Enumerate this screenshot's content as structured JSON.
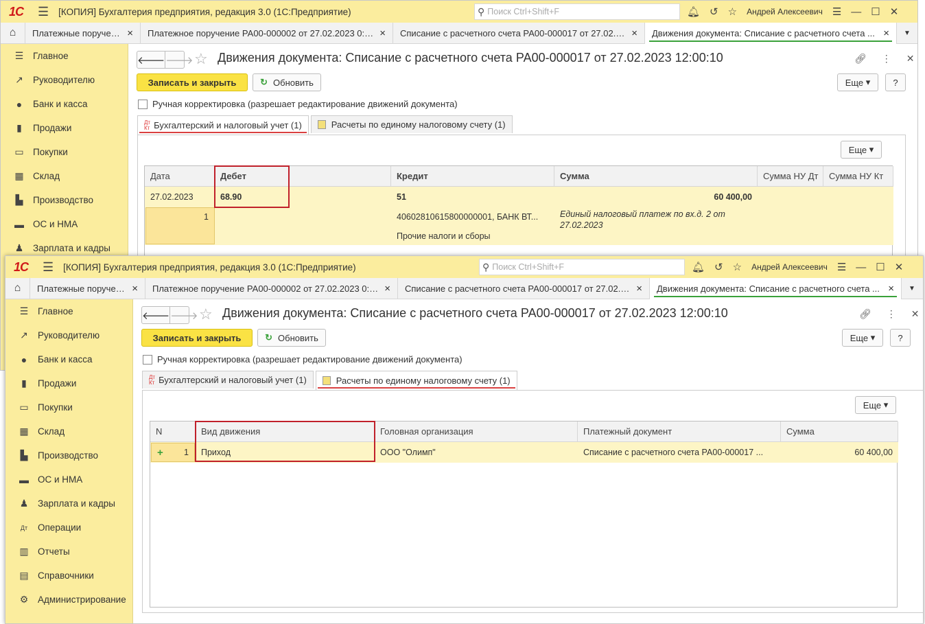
{
  "app": {
    "title": "[КОПИЯ] Бухгалтерия предприятия, редакция 3.0  (1С:Предприятие)",
    "logo": "1С",
    "search_placeholder": "Поиск Ctrl+Shift+F",
    "user": "Андрей Алексеевич"
  },
  "tabs": [
    {
      "label": "Платежные поручения"
    },
    {
      "label": "Платежное поручение РА00-000002 от 27.02.2023 0:0..."
    },
    {
      "label": "Списание с расчетного счета РА00-000017 от 27.02.2..."
    },
    {
      "label": "Движения документа: Списание с расчетного счета ..."
    }
  ],
  "sidebar": [
    "Главное",
    "Руководителю",
    "Банк и касса",
    "Продажи",
    "Покупки",
    "Склад",
    "Производство",
    "ОС и НМА",
    "Зарплата и кадры",
    "Операции",
    "Отчеты",
    "Справочники",
    "Администрирование"
  ],
  "doc": {
    "title": "Движения документа: Списание с расчетного счета РА00-000017 от 27.02.2023 12:00:10",
    "save_close": "Записать и закрыть",
    "refresh": "Обновить",
    "more": "Еще",
    "help": "?",
    "manual": "Ручная корректировка (разрешает редактирование движений документа)"
  },
  "doc_tabs": [
    {
      "label": "Бухгалтерский и налоговый учет (1)",
      "icon": "dt-kt-icon"
    },
    {
      "label": "Расчеты по единому налоговому счету (1)",
      "icon": "document-icon"
    }
  ],
  "dtkt": {
    "dt": "Дт",
    "kt": "Кт"
  },
  "table1": {
    "headers": [
      "Дата",
      "Дебет",
      "Кредит",
      "Сумма",
      "Сумма НУ Дт",
      "Сумма НУ Кт"
    ],
    "date": "27.02.2023",
    "num": "1",
    "debit": "68.90",
    "credit": "51",
    "amount": "60 400,00",
    "credit_sub1": "40602810615800000001, БАНК ВТ...",
    "credit_sub2": "Прочие налоги и сборы",
    "content": "Единый налоговый платеж по вх.д. 2 от 27.02.2023"
  },
  "table2": {
    "headers": [
      "N",
      "Вид движения",
      "Головная организация",
      "Платежный документ",
      "Сумма"
    ],
    "row": {
      "plus": "+",
      "n": "1",
      "kind": "Приход",
      "org": "ООО \"Олимп\"",
      "doc": "Списание с расчетного счета РА00-000017 ...",
      "sum": "60 400,00"
    }
  }
}
